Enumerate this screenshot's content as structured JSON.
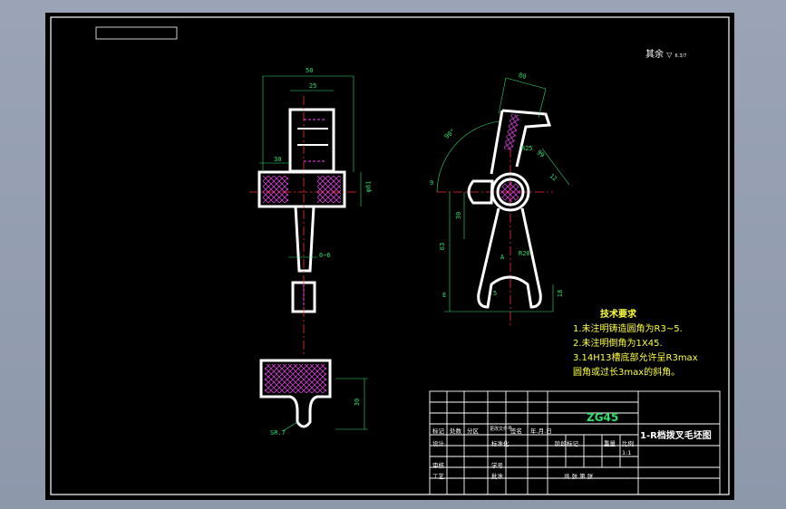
{
  "colors": {
    "background": "#8e98ab",
    "canvas": "#000000",
    "outline": "#ffffff",
    "dimension": "#2ee06a",
    "centerline": "#ff3030",
    "hatch": "#ff40ff",
    "notes": "#ffff3c",
    "title_material": "#2ee06a"
  },
  "surface_note": {
    "prefix": "其余",
    "symbol_value": "6.3/7"
  },
  "dimensions": {
    "width_50": "50",
    "width_25": "25",
    "len_30": "30",
    "dia_81": "φ81",
    "len_6": "6~6",
    "sec_30": "30",
    "sec_r": "SR.7",
    "d80": "80",
    "d30": "30",
    "r25": "R25",
    "d99": "99",
    "d12": "12",
    "d9": "9",
    "d63": "63",
    "d30b": "30",
    "angle": "90°",
    "r20": "R20",
    "letter_a": "A",
    "letter_e": "E",
    "d18": "18",
    "d5": "5"
  },
  "requirements": {
    "heading": "技术要求",
    "items": [
      "1.未注明铸造圆角为R3~5.",
      "2.未注明倒角为1X45.",
      "3.14H13槽底部允许呈R3max",
      "圆角或过长3max的斜角。"
    ]
  },
  "title_block": {
    "material": "ZG45",
    "drawing_title": "1-R档拨叉毛坯图",
    "row_labels": [
      "标记",
      "处数",
      "分区",
      "更改文件号",
      "签名",
      "年.月.日"
    ],
    "design": "设计",
    "standard": "标准化",
    "stage_mark": "阶段标记",
    "weight": "重量",
    "scale": "比例",
    "scale_value": "1:1",
    "review": "审核",
    "craft": "工艺",
    "approve": "批准",
    "student_no": "学号",
    "sheets": "共  张  第  张"
  }
}
